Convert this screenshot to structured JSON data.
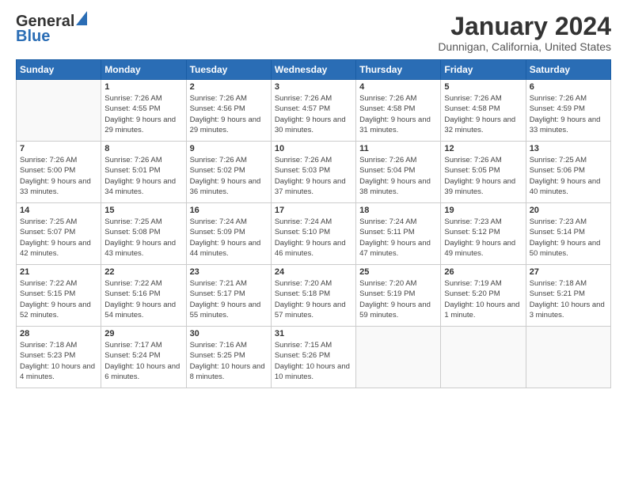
{
  "logo": {
    "line1": "General",
    "line2": "Blue"
  },
  "title": {
    "month_year": "January 2024",
    "location": "Dunnigan, California, United States"
  },
  "headers": [
    "Sunday",
    "Monday",
    "Tuesday",
    "Wednesday",
    "Thursday",
    "Friday",
    "Saturday"
  ],
  "weeks": [
    [
      {
        "num": "",
        "sunrise": "",
        "sunset": "",
        "daylight": ""
      },
      {
        "num": "1",
        "sunrise": "Sunrise: 7:26 AM",
        "sunset": "Sunset: 4:55 PM",
        "daylight": "Daylight: 9 hours and 29 minutes."
      },
      {
        "num": "2",
        "sunrise": "Sunrise: 7:26 AM",
        "sunset": "Sunset: 4:56 PM",
        "daylight": "Daylight: 9 hours and 29 minutes."
      },
      {
        "num": "3",
        "sunrise": "Sunrise: 7:26 AM",
        "sunset": "Sunset: 4:57 PM",
        "daylight": "Daylight: 9 hours and 30 minutes."
      },
      {
        "num": "4",
        "sunrise": "Sunrise: 7:26 AM",
        "sunset": "Sunset: 4:58 PM",
        "daylight": "Daylight: 9 hours and 31 minutes."
      },
      {
        "num": "5",
        "sunrise": "Sunrise: 7:26 AM",
        "sunset": "Sunset: 4:58 PM",
        "daylight": "Daylight: 9 hours and 32 minutes."
      },
      {
        "num": "6",
        "sunrise": "Sunrise: 7:26 AM",
        "sunset": "Sunset: 4:59 PM",
        "daylight": "Daylight: 9 hours and 33 minutes."
      }
    ],
    [
      {
        "num": "7",
        "sunrise": "Sunrise: 7:26 AM",
        "sunset": "Sunset: 5:00 PM",
        "daylight": "Daylight: 9 hours and 33 minutes."
      },
      {
        "num": "8",
        "sunrise": "Sunrise: 7:26 AM",
        "sunset": "Sunset: 5:01 PM",
        "daylight": "Daylight: 9 hours and 34 minutes."
      },
      {
        "num": "9",
        "sunrise": "Sunrise: 7:26 AM",
        "sunset": "Sunset: 5:02 PM",
        "daylight": "Daylight: 9 hours and 36 minutes."
      },
      {
        "num": "10",
        "sunrise": "Sunrise: 7:26 AM",
        "sunset": "Sunset: 5:03 PM",
        "daylight": "Daylight: 9 hours and 37 minutes."
      },
      {
        "num": "11",
        "sunrise": "Sunrise: 7:26 AM",
        "sunset": "Sunset: 5:04 PM",
        "daylight": "Daylight: 9 hours and 38 minutes."
      },
      {
        "num": "12",
        "sunrise": "Sunrise: 7:26 AM",
        "sunset": "Sunset: 5:05 PM",
        "daylight": "Daylight: 9 hours and 39 minutes."
      },
      {
        "num": "13",
        "sunrise": "Sunrise: 7:25 AM",
        "sunset": "Sunset: 5:06 PM",
        "daylight": "Daylight: 9 hours and 40 minutes."
      }
    ],
    [
      {
        "num": "14",
        "sunrise": "Sunrise: 7:25 AM",
        "sunset": "Sunset: 5:07 PM",
        "daylight": "Daylight: 9 hours and 42 minutes."
      },
      {
        "num": "15",
        "sunrise": "Sunrise: 7:25 AM",
        "sunset": "Sunset: 5:08 PM",
        "daylight": "Daylight: 9 hours and 43 minutes."
      },
      {
        "num": "16",
        "sunrise": "Sunrise: 7:24 AM",
        "sunset": "Sunset: 5:09 PM",
        "daylight": "Daylight: 9 hours and 44 minutes."
      },
      {
        "num": "17",
        "sunrise": "Sunrise: 7:24 AM",
        "sunset": "Sunset: 5:10 PM",
        "daylight": "Daylight: 9 hours and 46 minutes."
      },
      {
        "num": "18",
        "sunrise": "Sunrise: 7:24 AM",
        "sunset": "Sunset: 5:11 PM",
        "daylight": "Daylight: 9 hours and 47 minutes."
      },
      {
        "num": "19",
        "sunrise": "Sunrise: 7:23 AM",
        "sunset": "Sunset: 5:12 PM",
        "daylight": "Daylight: 9 hours and 49 minutes."
      },
      {
        "num": "20",
        "sunrise": "Sunrise: 7:23 AM",
        "sunset": "Sunset: 5:14 PM",
        "daylight": "Daylight: 9 hours and 50 minutes."
      }
    ],
    [
      {
        "num": "21",
        "sunrise": "Sunrise: 7:22 AM",
        "sunset": "Sunset: 5:15 PM",
        "daylight": "Daylight: 9 hours and 52 minutes."
      },
      {
        "num": "22",
        "sunrise": "Sunrise: 7:22 AM",
        "sunset": "Sunset: 5:16 PM",
        "daylight": "Daylight: 9 hours and 54 minutes."
      },
      {
        "num": "23",
        "sunrise": "Sunrise: 7:21 AM",
        "sunset": "Sunset: 5:17 PM",
        "daylight": "Daylight: 9 hours and 55 minutes."
      },
      {
        "num": "24",
        "sunrise": "Sunrise: 7:20 AM",
        "sunset": "Sunset: 5:18 PM",
        "daylight": "Daylight: 9 hours and 57 minutes."
      },
      {
        "num": "25",
        "sunrise": "Sunrise: 7:20 AM",
        "sunset": "Sunset: 5:19 PM",
        "daylight": "Daylight: 9 hours and 59 minutes."
      },
      {
        "num": "26",
        "sunrise": "Sunrise: 7:19 AM",
        "sunset": "Sunset: 5:20 PM",
        "daylight": "Daylight: 10 hours and 1 minute."
      },
      {
        "num": "27",
        "sunrise": "Sunrise: 7:18 AM",
        "sunset": "Sunset: 5:21 PM",
        "daylight": "Daylight: 10 hours and 3 minutes."
      }
    ],
    [
      {
        "num": "28",
        "sunrise": "Sunrise: 7:18 AM",
        "sunset": "Sunset: 5:23 PM",
        "daylight": "Daylight: 10 hours and 4 minutes."
      },
      {
        "num": "29",
        "sunrise": "Sunrise: 7:17 AM",
        "sunset": "Sunset: 5:24 PM",
        "daylight": "Daylight: 10 hours and 6 minutes."
      },
      {
        "num": "30",
        "sunrise": "Sunrise: 7:16 AM",
        "sunset": "Sunset: 5:25 PM",
        "daylight": "Daylight: 10 hours and 8 minutes."
      },
      {
        "num": "31",
        "sunrise": "Sunrise: 7:15 AM",
        "sunset": "Sunset: 5:26 PM",
        "daylight": "Daylight: 10 hours and 10 minutes."
      },
      {
        "num": "",
        "sunrise": "",
        "sunset": "",
        "daylight": ""
      },
      {
        "num": "",
        "sunrise": "",
        "sunset": "",
        "daylight": ""
      },
      {
        "num": "",
        "sunrise": "",
        "sunset": "",
        "daylight": ""
      }
    ]
  ]
}
